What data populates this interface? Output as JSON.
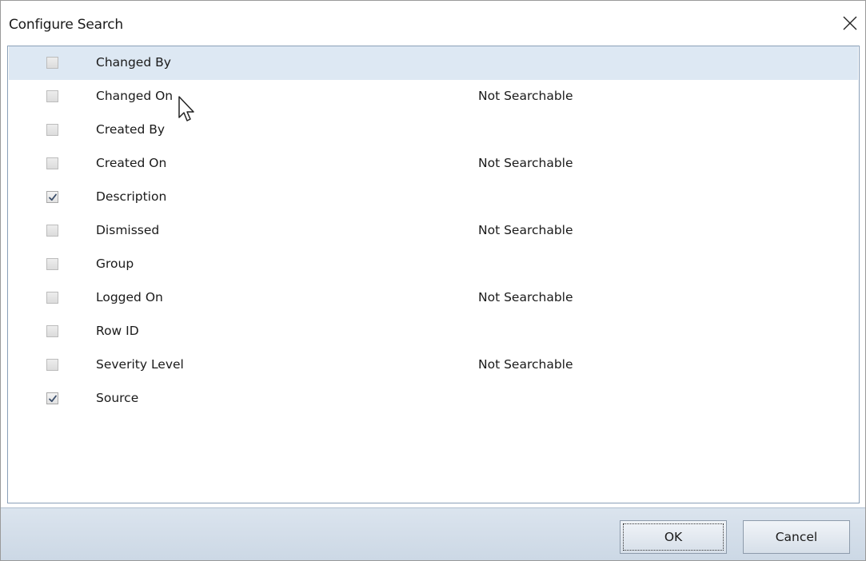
{
  "dialog": {
    "title": "Configure Search",
    "close_icon": "close-icon"
  },
  "fields": [
    {
      "label": "Changed By",
      "checked": false,
      "status": "",
      "selected": true
    },
    {
      "label": "Changed On",
      "checked": false,
      "status": "Not Searchable",
      "selected": false
    },
    {
      "label": "Created By",
      "checked": false,
      "status": "",
      "selected": false
    },
    {
      "label": "Created On",
      "checked": false,
      "status": "Not Searchable",
      "selected": false
    },
    {
      "label": "Description",
      "checked": true,
      "status": "",
      "selected": false
    },
    {
      "label": "Dismissed",
      "checked": false,
      "status": "Not Searchable",
      "selected": false
    },
    {
      "label": "Group",
      "checked": false,
      "status": "",
      "selected": false
    },
    {
      "label": "Logged On",
      "checked": false,
      "status": "Not Searchable",
      "selected": false
    },
    {
      "label": "Row ID",
      "checked": false,
      "status": "",
      "selected": false
    },
    {
      "label": "Severity Level",
      "checked": false,
      "status": "Not Searchable",
      "selected": false
    },
    {
      "label": "Source",
      "checked": true,
      "status": "",
      "selected": false
    }
  ],
  "footer": {
    "ok_label": "OK",
    "cancel_label": "Cancel"
  },
  "colors": {
    "selected_row": "#dde8f3",
    "footer_bg": "#d3dde8",
    "list_border": "#8aa0b8"
  }
}
